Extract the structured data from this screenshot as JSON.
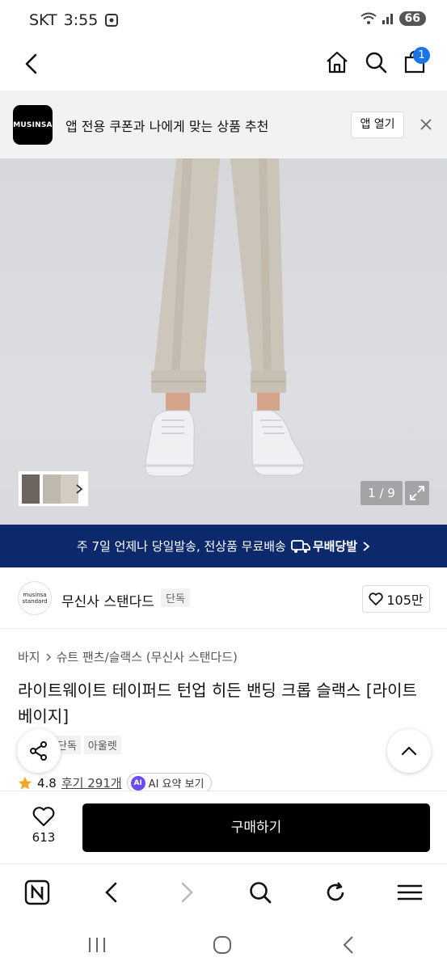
{
  "status_bar": {
    "carrier": "SKT",
    "time": "3:55",
    "battery": "66"
  },
  "nav": {
    "cart_count": "1"
  },
  "app_banner": {
    "logo_text": "MUSINSA",
    "message": "앱 전용 쿠폰과 나에게 맞는 상품 추천",
    "open_app_label": "앱 열기"
  },
  "gallery": {
    "pager": "1 / 9"
  },
  "shipping_bar": {
    "text": "주 7일 언제나 당일발송, 전상품 무료배송",
    "badge": "무배당발"
  },
  "brand": {
    "logo_line1": "musinsa",
    "logo_line2": "standard",
    "name": "무신사 스탠다드",
    "exclusive_tag": "단독",
    "likes": "105만"
  },
  "breadcrumb": {
    "category": "바지",
    "subcategory": "슈트 팬츠/슬랙스 (무신사 스탠다드)"
  },
  "product": {
    "title": "라이트웨이트 테이퍼드 턴업 히든 밴딩 크롭 슬랙스 [라이트 베이지]",
    "tags": [
      "단독",
      "아울렛"
    ],
    "rating": "4.8",
    "reviews": "후기 291개",
    "ai_label": "AI",
    "ai_summary": "AI 요약 보기"
  },
  "purchase_bar": {
    "wish_count": "613",
    "buy_label": "구매하기"
  },
  "colors": {
    "brand_navy": "#0c2a6b",
    "accent_blue": "#1a73e8",
    "black": "#000000"
  }
}
